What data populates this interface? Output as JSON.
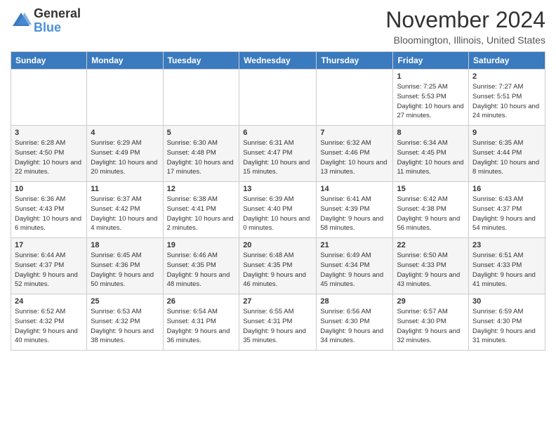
{
  "header": {
    "logo_general": "General",
    "logo_blue": "Blue",
    "month_year": "November 2024",
    "location": "Bloomington, Illinois, United States"
  },
  "columns": [
    "Sunday",
    "Monday",
    "Tuesday",
    "Wednesday",
    "Thursday",
    "Friday",
    "Saturday"
  ],
  "weeks": [
    [
      {
        "day": "",
        "info": ""
      },
      {
        "day": "",
        "info": ""
      },
      {
        "day": "",
        "info": ""
      },
      {
        "day": "",
        "info": ""
      },
      {
        "day": "",
        "info": ""
      },
      {
        "day": "1",
        "info": "Sunrise: 7:25 AM\nSunset: 5:53 PM\nDaylight: 10 hours and 27 minutes."
      },
      {
        "day": "2",
        "info": "Sunrise: 7:27 AM\nSunset: 5:51 PM\nDaylight: 10 hours and 24 minutes."
      }
    ],
    [
      {
        "day": "3",
        "info": "Sunrise: 6:28 AM\nSunset: 4:50 PM\nDaylight: 10 hours and 22 minutes."
      },
      {
        "day": "4",
        "info": "Sunrise: 6:29 AM\nSunset: 4:49 PM\nDaylight: 10 hours and 20 minutes."
      },
      {
        "day": "5",
        "info": "Sunrise: 6:30 AM\nSunset: 4:48 PM\nDaylight: 10 hours and 17 minutes."
      },
      {
        "day": "6",
        "info": "Sunrise: 6:31 AM\nSunset: 4:47 PM\nDaylight: 10 hours and 15 minutes."
      },
      {
        "day": "7",
        "info": "Sunrise: 6:32 AM\nSunset: 4:46 PM\nDaylight: 10 hours and 13 minutes."
      },
      {
        "day": "8",
        "info": "Sunrise: 6:34 AM\nSunset: 4:45 PM\nDaylight: 10 hours and 11 minutes."
      },
      {
        "day": "9",
        "info": "Sunrise: 6:35 AM\nSunset: 4:44 PM\nDaylight: 10 hours and 8 minutes."
      }
    ],
    [
      {
        "day": "10",
        "info": "Sunrise: 6:36 AM\nSunset: 4:43 PM\nDaylight: 10 hours and 6 minutes."
      },
      {
        "day": "11",
        "info": "Sunrise: 6:37 AM\nSunset: 4:42 PM\nDaylight: 10 hours and 4 minutes."
      },
      {
        "day": "12",
        "info": "Sunrise: 6:38 AM\nSunset: 4:41 PM\nDaylight: 10 hours and 2 minutes."
      },
      {
        "day": "13",
        "info": "Sunrise: 6:39 AM\nSunset: 4:40 PM\nDaylight: 10 hours and 0 minutes."
      },
      {
        "day": "14",
        "info": "Sunrise: 6:41 AM\nSunset: 4:39 PM\nDaylight: 9 hours and 58 minutes."
      },
      {
        "day": "15",
        "info": "Sunrise: 6:42 AM\nSunset: 4:38 PM\nDaylight: 9 hours and 56 minutes."
      },
      {
        "day": "16",
        "info": "Sunrise: 6:43 AM\nSunset: 4:37 PM\nDaylight: 9 hours and 54 minutes."
      }
    ],
    [
      {
        "day": "17",
        "info": "Sunrise: 6:44 AM\nSunset: 4:37 PM\nDaylight: 9 hours and 52 minutes."
      },
      {
        "day": "18",
        "info": "Sunrise: 6:45 AM\nSunset: 4:36 PM\nDaylight: 9 hours and 50 minutes."
      },
      {
        "day": "19",
        "info": "Sunrise: 6:46 AM\nSunset: 4:35 PM\nDaylight: 9 hours and 48 minutes."
      },
      {
        "day": "20",
        "info": "Sunrise: 6:48 AM\nSunset: 4:35 PM\nDaylight: 9 hours and 46 minutes."
      },
      {
        "day": "21",
        "info": "Sunrise: 6:49 AM\nSunset: 4:34 PM\nDaylight: 9 hours and 45 minutes."
      },
      {
        "day": "22",
        "info": "Sunrise: 6:50 AM\nSunset: 4:33 PM\nDaylight: 9 hours and 43 minutes."
      },
      {
        "day": "23",
        "info": "Sunrise: 6:51 AM\nSunset: 4:33 PM\nDaylight: 9 hours and 41 minutes."
      }
    ],
    [
      {
        "day": "24",
        "info": "Sunrise: 6:52 AM\nSunset: 4:32 PM\nDaylight: 9 hours and 40 minutes."
      },
      {
        "day": "25",
        "info": "Sunrise: 6:53 AM\nSunset: 4:32 PM\nDaylight: 9 hours and 38 minutes."
      },
      {
        "day": "26",
        "info": "Sunrise: 6:54 AM\nSunset: 4:31 PM\nDaylight: 9 hours and 36 minutes."
      },
      {
        "day": "27",
        "info": "Sunrise: 6:55 AM\nSunset: 4:31 PM\nDaylight: 9 hours and 35 minutes."
      },
      {
        "day": "28",
        "info": "Sunrise: 6:56 AM\nSunset: 4:30 PM\nDaylight: 9 hours and 34 minutes."
      },
      {
        "day": "29",
        "info": "Sunrise: 6:57 AM\nSunset: 4:30 PM\nDaylight: 9 hours and 32 minutes."
      },
      {
        "day": "30",
        "info": "Sunrise: 6:59 AM\nSunset: 4:30 PM\nDaylight: 9 hours and 31 minutes."
      }
    ]
  ]
}
